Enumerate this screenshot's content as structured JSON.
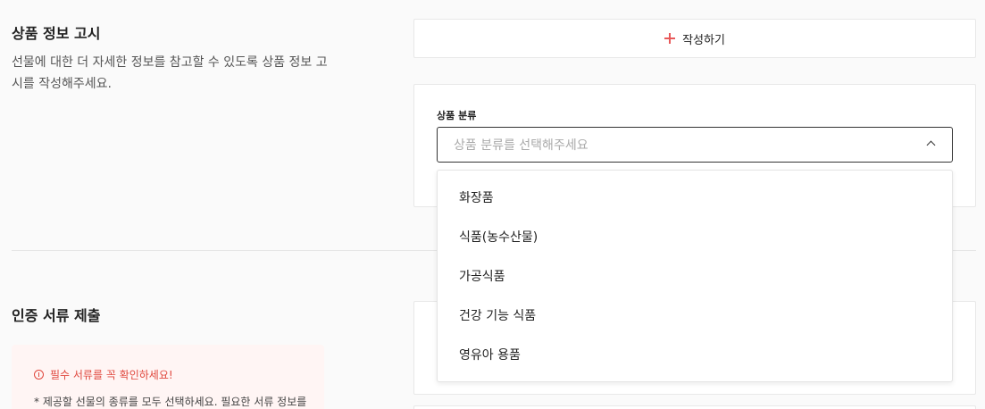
{
  "product_info": {
    "title": "상품 정보 고시",
    "description_line1": "선물에 대한 더 자세한 정보를 참고할 수 있도록 상품 정보 고",
    "description_line2": "시를 작성해주세요.",
    "write_button_label": "작성하기",
    "category_label": "상품 분류",
    "category_placeholder": "상품 분류를 선택해주세요",
    "category_options": [
      "화장품",
      "식품(농수산물)",
      "가공식품",
      "건강 기능 식품",
      "영유아 용품"
    ]
  },
  "certification": {
    "title": "인증 서류 제출",
    "alert_title": "필수 서류를 꼭 확인하세요!",
    "alert_body": "*  제공할 선물의 종류를 모두 선택하세요. 필요한 서류 정보를"
  },
  "colors": {
    "accent": "#e8595a",
    "alert_text": "#e0483e",
    "alert_bg": "#fff5f4"
  }
}
